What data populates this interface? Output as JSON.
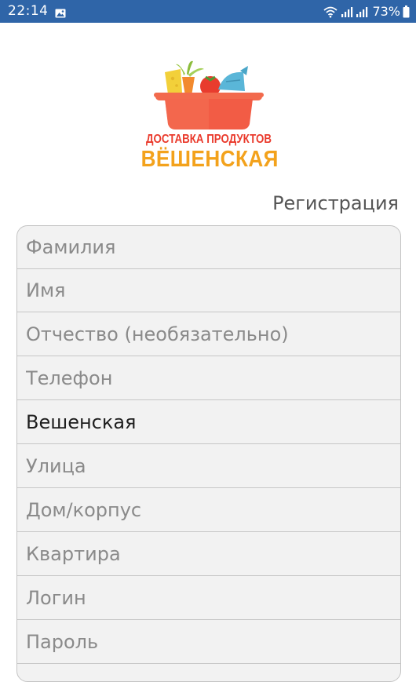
{
  "status_bar": {
    "time": "22:14",
    "battery_percent": "73%",
    "background": "#2f65a8"
  },
  "logo": {
    "line1": "ДОСТАВКА ПРОДУКТОВ",
    "line2": "ВЁШЕНСКАЯ"
  },
  "screen_title": "Регистрация",
  "form": {
    "fields": [
      {
        "placeholder": "Фамилия",
        "value": ""
      },
      {
        "placeholder": "Имя",
        "value": ""
      },
      {
        "placeholder": "Отчество (необязательно)",
        "value": ""
      },
      {
        "placeholder": "Телефон",
        "value": ""
      },
      {
        "placeholder": "",
        "value": "Вешенская"
      },
      {
        "placeholder": "Улица",
        "value": ""
      },
      {
        "placeholder": "Дом/корпус",
        "value": ""
      },
      {
        "placeholder": "Квартира",
        "value": ""
      },
      {
        "placeholder": "Логин",
        "value": ""
      },
      {
        "placeholder": "Пароль",
        "value": ""
      }
    ]
  },
  "colors": {
    "accent": "#2f65a8",
    "logo_red": "#ea3a2c",
    "logo_orange": "#f3a21c"
  }
}
